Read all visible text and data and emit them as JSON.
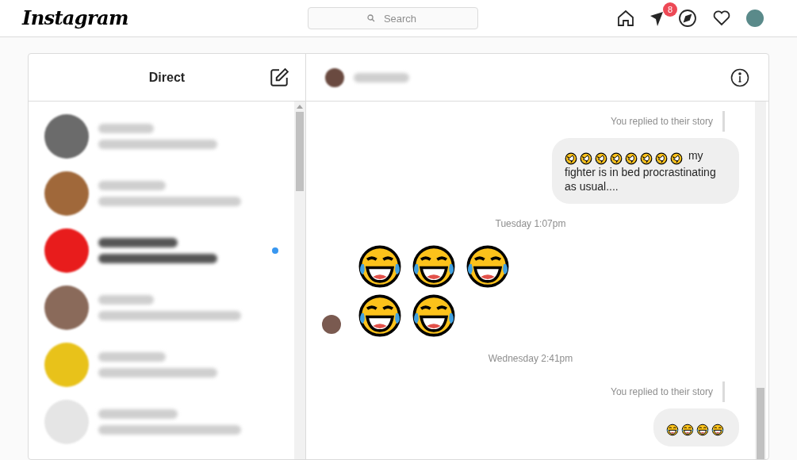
{
  "logo": "Instagram",
  "search": {
    "placeholder": "Search"
  },
  "nav": {
    "notification_count": "8"
  },
  "direct": {
    "title": "Direct"
  },
  "conversations": [
    {
      "unread": false
    },
    {
      "unread": false
    },
    {
      "unread": true
    },
    {
      "unread": false
    },
    {
      "unread": false
    },
    {
      "unread": false
    }
  ],
  "messages": [
    {
      "kind": "note",
      "text": "You replied to their story"
    },
    {
      "kind": "sent",
      "parts": [
        {
          "kind": "rofl"
        },
        {
          "kind": "rofl"
        },
        {
          "kind": "rofl"
        },
        {
          "kind": "rofl"
        },
        {
          "kind": "rofl"
        },
        {
          "kind": "rofl"
        },
        {
          "kind": "rofl"
        },
        {
          "kind": "rofl"
        },
        {
          "kind": "text",
          "text": "my fighter is in bed procrastinating as usual...."
        }
      ]
    },
    {
      "kind": "time",
      "text": "Tuesday 1:07pm"
    },
    {
      "kind": "big_emoji",
      "rows": [
        [
          {
            "kind": "joy"
          },
          {
            "kind": "joy"
          },
          {
            "kind": "joy"
          }
        ],
        [
          {
            "kind": "joy"
          },
          {
            "kind": "joy"
          }
        ]
      ]
    },
    {
      "kind": "time",
      "text": "Wednesday 2:41pm"
    },
    {
      "kind": "note",
      "text": "You replied to their story"
    },
    {
      "kind": "sent",
      "parts": [
        {
          "kind": "joy"
        },
        {
          "kind": "joy"
        },
        {
          "kind": "joy"
        },
        {
          "kind": "joy"
        }
      ]
    }
  ]
}
